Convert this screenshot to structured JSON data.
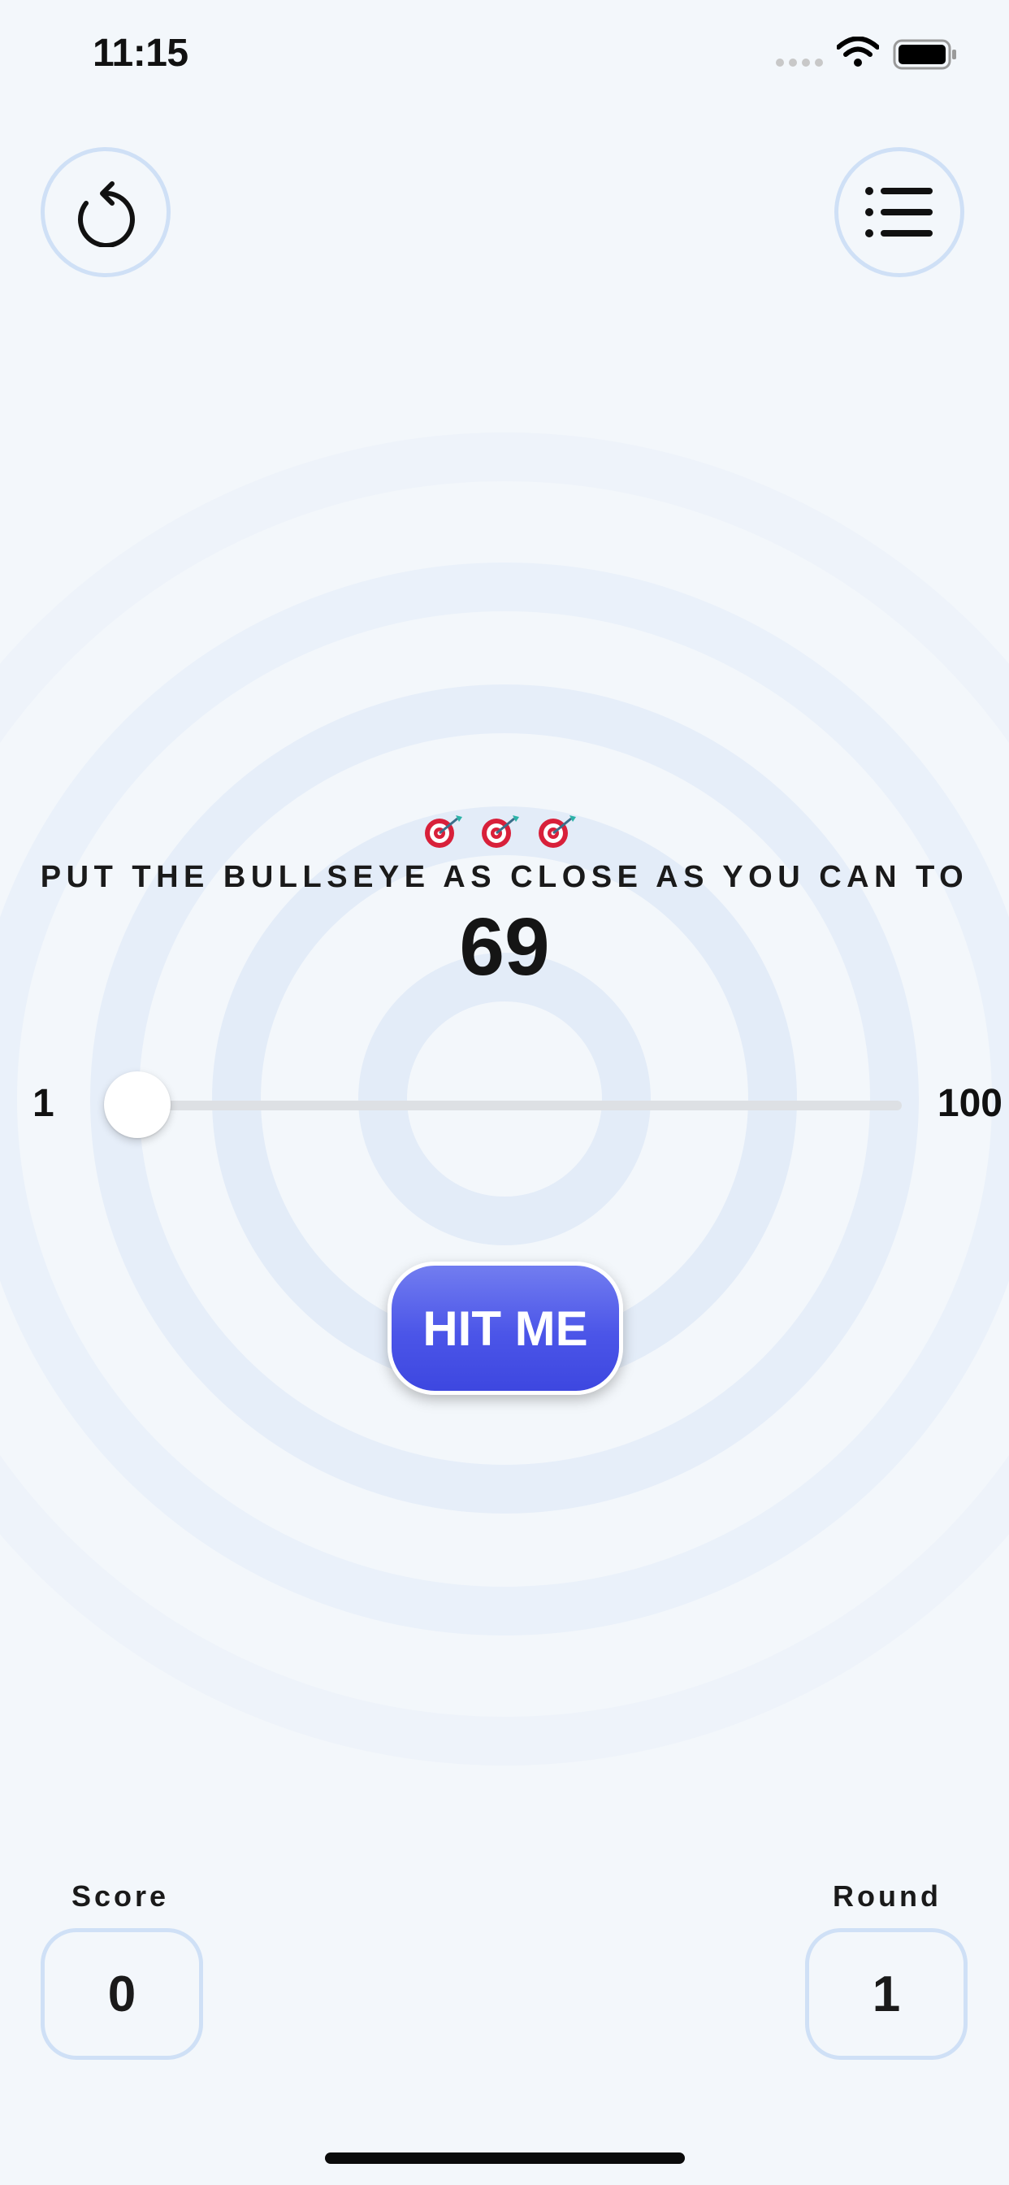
{
  "status_bar": {
    "time": "11:15"
  },
  "toolbar": {
    "restart_icon": "restart-icon",
    "leaderboard_icon": "list-icon"
  },
  "game": {
    "instruction": "PUT THE BULLSEYE AS CLOSE AS YOU CAN TO",
    "target": "69",
    "slider": {
      "min_label": "1",
      "max_label": "100",
      "value": 1
    },
    "hit_button": "HIT ME"
  },
  "stats": {
    "score_label": "Score",
    "score": "0",
    "round_label": "Round",
    "round": "1"
  },
  "colors": {
    "accent": "#4b55e8",
    "background": "#f3f7fb",
    "ring": "#e8f0fa",
    "border": "#cfe0f6"
  }
}
